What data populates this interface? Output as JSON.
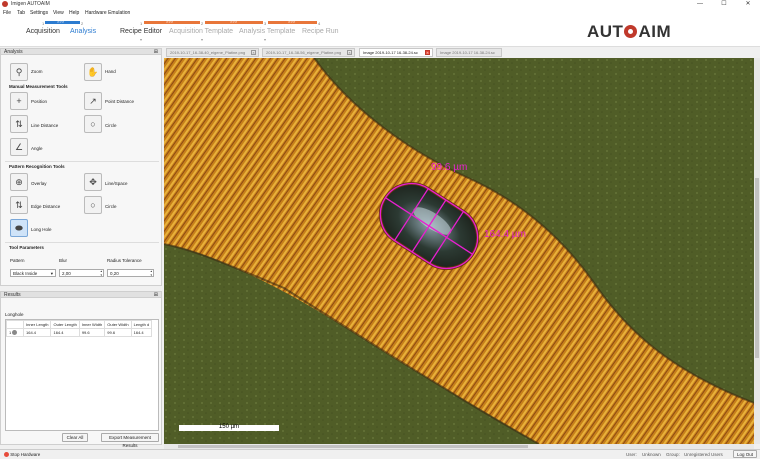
{
  "window": {
    "title": "Imigen AUTOAIM",
    "min": "—",
    "max": "☐",
    "close": "✕"
  },
  "menu": [
    "File",
    "Tab",
    "Settings",
    "View",
    "Help",
    "Hardware Emulation"
  ],
  "workflow": {
    "steps": [
      {
        "num": "1",
        "label": "Acquisition"
      },
      {
        "num": "2",
        "label": "Analysis"
      },
      {
        "num": "1",
        "label": "Recipe Editor"
      },
      {
        "num": "2",
        "label": "Acquisition Template"
      },
      {
        "num": "3",
        "label": "Analysis Template"
      },
      {
        "num": "4",
        "label": "Recipe Run"
      }
    ],
    "arrows": "> > >",
    "colors": {
      "blue": "#2b7bd0",
      "orange": "#e8763a"
    }
  },
  "logo": {
    "left": "AUT",
    "right": "AIM",
    "circle_color": "#c0392b"
  },
  "analysis_panel": {
    "title": "Analysis",
    "pin": "⊞",
    "zoom": "Zoom",
    "hand": "Hand",
    "manual_title": "Manual Measurement Tools",
    "position": "Position",
    "point_distance": "Point Distance",
    "line_distance": "Line Distance",
    "circle": "Circle",
    "angle": "Angle",
    "pattern_title": "Pattern Recognition Tools",
    "overlay": "Overlay",
    "line_space": "Line/Space",
    "edge_distance": "Edge Distance",
    "circle2": "Circle",
    "long_hole": "Long Hole",
    "params_title": "Tool Parameters",
    "pattern_label": "Pattern",
    "blur_label": "Blur",
    "radius_label": "Radius Tolerance",
    "pattern_value": "Black Inside",
    "blur_value": "2,00",
    "radius_value": "0,20"
  },
  "results_panel": {
    "title": "Results",
    "pin": "⊞",
    "group": "Longhole",
    "columns": [
      "Inner Length",
      "Outer Length",
      "Inner Width",
      "Outer Width",
      "Length d"
    ],
    "row_num": "1",
    "row": [
      "164.4",
      "164.4",
      "99.6",
      "99.6",
      "164.4"
    ],
    "clear_all": "Clear All",
    "export": "Export Measurement Results"
  },
  "tabs": [
    "2019-10-17_16-38-40_eigene_Platine.png",
    "2019-10-17_16-38-56_eigene_Platine.png",
    "Image 2019-10-17 16-38-24.sc",
    "Image 2019-10-17 16-38-24.sc"
  ],
  "tab_close": "×",
  "image": {
    "width_label": "99.6 µm",
    "length_label": "164.4 µm",
    "scale_label": "150 µm",
    "measure_color": "#e81fd0"
  },
  "status": {
    "stop_hardware": "Stop Hardware",
    "user_label": "User:",
    "user_value": "Unknown",
    "group_label": "Group:",
    "group_value": "Unregistered Users",
    "logout": "Log Out"
  }
}
